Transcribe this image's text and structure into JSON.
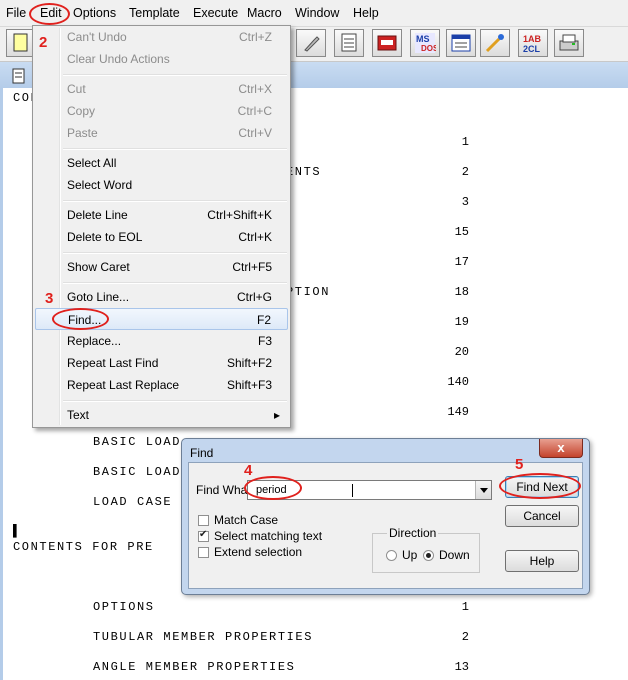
{
  "menubar": {
    "items": [
      "File",
      "Edit",
      "Options",
      "Template",
      "Execute",
      "Macro",
      "Window",
      "Help"
    ]
  },
  "toolbar": {
    "icons": [
      "new-file-icon",
      "gear-icon",
      "list-icon",
      "tape-icon",
      "ms-dos-icon",
      "window-icon",
      "tools-icon",
      "abc-sort-icon",
      "printer-icon"
    ],
    "ms_dos_text": "MS DOS",
    "abc_text_1": "1AB",
    "abc_text_2": "2CL"
  },
  "document": {
    "lines": [
      {
        "text": "CON"
      },
      {
        "text": "ENTS",
        "prefix": ""
      },
      {
        "text": "PTION"
      },
      {
        "text": "BASIC LOAD"
      },
      {
        "text": "BASIC LOAD"
      },
      {
        "text": "LOAD CASE C"
      },
      {
        "text": "CONTENTS FOR PRE"
      },
      {
        "text": "OPTIONS"
      },
      {
        "text": "TUBULAR MEMBER PROPERTIES"
      },
      {
        "text": "ANGLE MEMBER PROPERTIES"
      }
    ],
    "numbers": [
      "1",
      "2",
      "3",
      "15",
      "17",
      "18",
      "19",
      "20",
      "140",
      "149",
      "1",
      "2",
      "13"
    ],
    "cursor_mark": "▌"
  },
  "edit_menu": {
    "items": [
      {
        "label": "Can't Undo",
        "shortcut": "Ctrl+Z",
        "disabled": true
      },
      {
        "label": "Clear Undo Actions",
        "shortcut": "",
        "disabled": true
      },
      {
        "label": "Cut",
        "shortcut": "Ctrl+X",
        "disabled": true
      },
      {
        "label": "Copy",
        "shortcut": "Ctrl+C",
        "disabled": true
      },
      {
        "label": "Paste",
        "shortcut": "Ctrl+V",
        "disabled": true
      },
      {
        "label": "Select All",
        "shortcut": ""
      },
      {
        "label": "Select Word",
        "shortcut": ""
      },
      {
        "label": "Delete Line",
        "shortcut": "Ctrl+Shift+K"
      },
      {
        "label": "Delete to EOL",
        "shortcut": "Ctrl+K"
      },
      {
        "label": "Show Caret",
        "shortcut": "Ctrl+F5"
      },
      {
        "label": "Goto Line...",
        "shortcut": "Ctrl+G"
      },
      {
        "label": "Find...",
        "shortcut": "F2",
        "highlighted": true
      },
      {
        "label": "Replace...",
        "shortcut": "F3"
      },
      {
        "label": "Repeat Last Find",
        "shortcut": "Shift+F2"
      },
      {
        "label": "Repeat Last Replace",
        "shortcut": "Shift+F3"
      },
      {
        "label": "Text",
        "shortcut": "",
        "submenu": true
      }
    ],
    "submenu_arrow": "▸"
  },
  "find_dialog": {
    "title": "Find",
    "close_label": "x",
    "find_what_label": "Find What",
    "find_what_value": "period",
    "match_case_label": "Match Case",
    "match_case_checked": false,
    "select_matching_label": "Select matching text",
    "select_matching_checked": true,
    "extend_selection_label": "Extend selection",
    "extend_selection_checked": false,
    "direction_label": "Direction",
    "up_label": "Up",
    "down_label": "Down",
    "direction_selected": "Down",
    "find_next_label": "Find Next",
    "cancel_label": "Cancel",
    "help_label": "Help"
  },
  "annotations": [
    "2",
    "3",
    "4",
    "5"
  ],
  "colors": {
    "annotation": "#e0211d",
    "menu_highlight": "#dde9f8",
    "dialog_frame": "#c3d6ee"
  }
}
